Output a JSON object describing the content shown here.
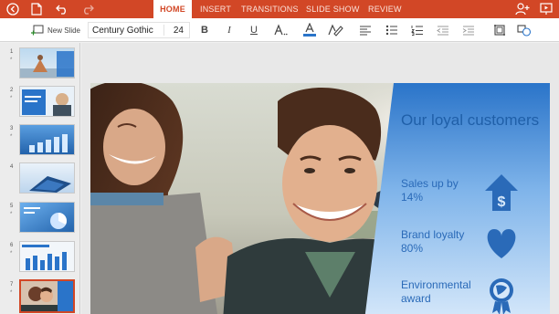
{
  "app": {
    "accent": "#d24726",
    "tabs": [
      "HOME",
      "INSERT",
      "TRANSITIONS",
      "SLIDE SHOW",
      "REVIEW"
    ],
    "active_tab": "HOME"
  },
  "toolbar": {
    "new_slide_label": "New Slide",
    "font_name": "Century Gothic",
    "font_size": "24",
    "bold_label": "B",
    "italic_label": "I",
    "underline_label": "U",
    "font_color_label": "A"
  },
  "thumbnails": {
    "numbers": [
      "1",
      "2",
      "3",
      "4",
      "5",
      "6",
      "7"
    ],
    "star": "*",
    "selected": "7"
  },
  "slide": {
    "title": "Our loyal customers",
    "stats": [
      {
        "label": "Sales up by",
        "value": "14%",
        "icon": "dollar-up-arrow-icon"
      },
      {
        "label": "Brand loyalty",
        "value": "80%",
        "icon": "heart-icon"
      },
      {
        "label": "Environmental",
        "value": "award",
        "icon": "globe-award-icon"
      }
    ],
    "panel_color": "#2a74c9"
  }
}
